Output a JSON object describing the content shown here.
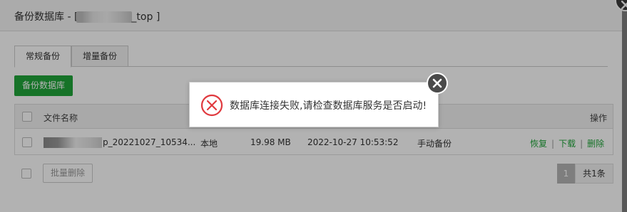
{
  "dialog": {
    "title_prefix": "备份数据库 - [",
    "title_suffix": "_top ]"
  },
  "tabs": [
    {
      "label": "常规备份",
      "active": true
    },
    {
      "label": "增量备份",
      "active": false
    }
  ],
  "toolbar": {
    "backup_label": "备份数据库"
  },
  "table": {
    "headers": {
      "filename": "文件名称",
      "actions": "操作"
    },
    "rows": [
      {
        "filename_suffix": "p_20221027_10534...",
        "location": "本地",
        "size": "19.98 MB",
        "time": "2022-10-27 10:53:52",
        "type": "手动备份",
        "actions": [
          "恢复",
          "下载",
          "删除"
        ]
      }
    ]
  },
  "footer": {
    "batch_delete_label": "批量删除",
    "pager": {
      "current": "1",
      "total": "共1条"
    }
  },
  "toast": {
    "message": "数据库连接失败,请检查数据库服务是否启动!",
    "icon": "error-circle-icon",
    "color": "#e0393e"
  },
  "colors": {
    "accent": "#20a53a",
    "error": "#e0393e"
  }
}
